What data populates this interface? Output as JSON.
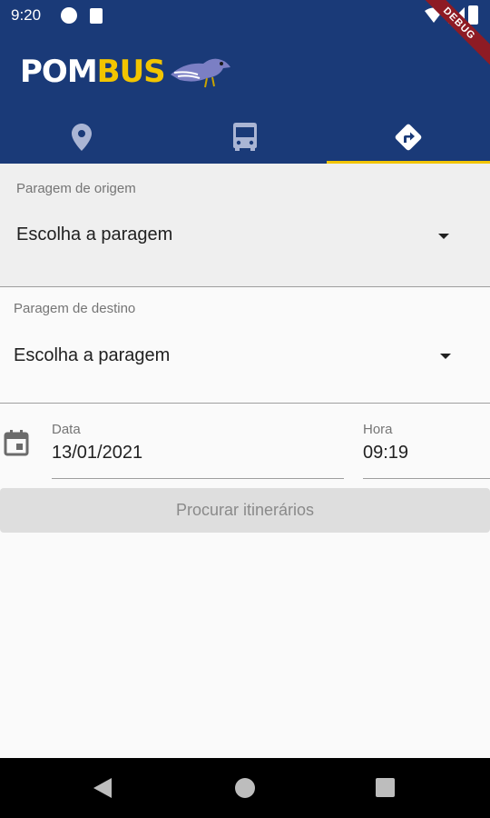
{
  "status_bar": {
    "time": "9:20"
  },
  "debug_banner": "DEBUG",
  "app": {
    "logo_part1": "POM",
    "logo_part2": "BUS"
  },
  "tabs": [
    {
      "icon": "location-pin-icon"
    },
    {
      "icon": "bus-icon"
    },
    {
      "icon": "directions-icon",
      "active": true
    }
  ],
  "origin": {
    "label": "Paragem de origem",
    "value": "Escolha a paragem"
  },
  "destination": {
    "label": "Paragem de destino",
    "value": "Escolha a paragem"
  },
  "date": {
    "label": "Data",
    "value": "13/01/2021"
  },
  "time": {
    "label": "Hora",
    "value": "09:19"
  },
  "search_button": "Procurar itinerários",
  "colors": {
    "primary": "#1a3a78",
    "accent": "#f2c500"
  }
}
